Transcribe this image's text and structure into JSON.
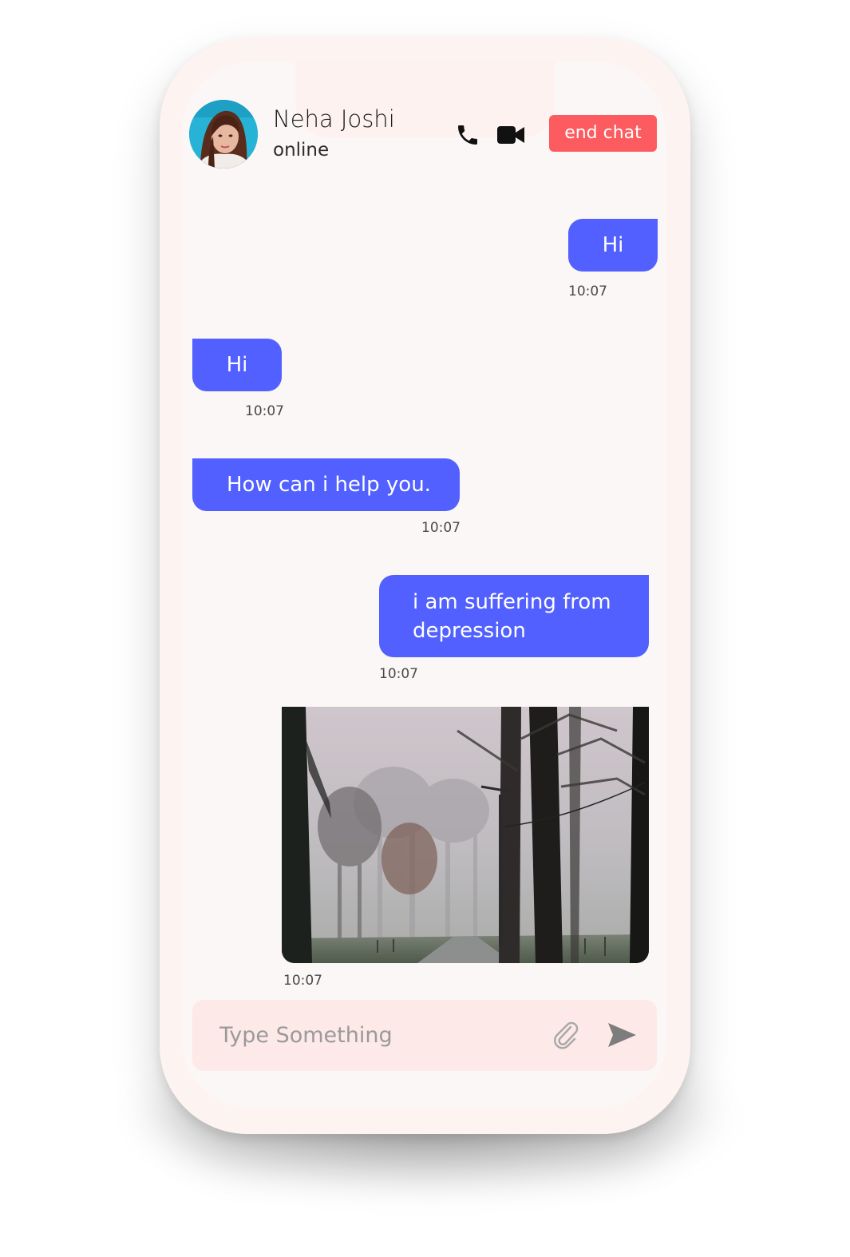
{
  "header": {
    "contact_name": "Neha Joshi",
    "contact_status": "online",
    "call_icon": "phone-icon",
    "video_icon": "video-camera-icon",
    "end_chat_label": "end chat",
    "end_chat_color": "#fc5b5f"
  },
  "messages": [
    {
      "direction": "outgoing",
      "text": "Hi",
      "time": "10:07"
    },
    {
      "direction": "incoming",
      "text": "Hi",
      "time": "10:07"
    },
    {
      "direction": "incoming",
      "text": "How can i help you.",
      "time": "10:07"
    },
    {
      "direction": "outgoing",
      "text": "i am suffering from depression",
      "time": "10:07"
    },
    {
      "direction": "outgoing",
      "type": "image",
      "time": "10:07"
    }
  ],
  "composer": {
    "placeholder": "Type Something",
    "attach_icon": "paperclip-icon",
    "send_icon": "send-icon"
  },
  "theme": {
    "bubble_color": "#5160ff",
    "screen_background": "#fbf7f6",
    "composer_background": "#fde9e8"
  }
}
